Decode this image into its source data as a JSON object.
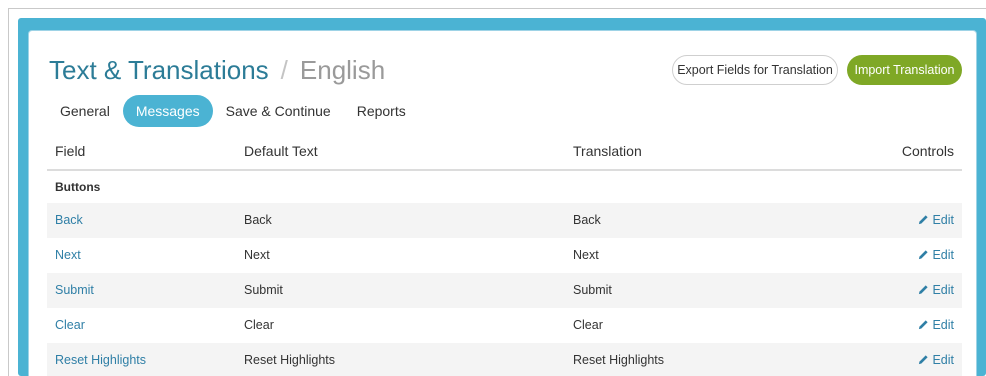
{
  "header": {
    "title": "Text & Translations",
    "separator": "/",
    "language": "English"
  },
  "buttons": {
    "export": "Export Fields for Translation",
    "import": "Import Translation"
  },
  "tabs": [
    {
      "label": "General",
      "active": false
    },
    {
      "label": "Messages",
      "active": true
    },
    {
      "label": "Save & Continue",
      "active": false
    },
    {
      "label": "Reports",
      "active": false
    }
  ],
  "table": {
    "columns": [
      "Field",
      "Default Text",
      "Translation",
      "Controls"
    ],
    "group": "Buttons",
    "rows": [
      {
        "field": "Back",
        "default": "Back",
        "translation": "Back",
        "control": "Edit"
      },
      {
        "field": "Next",
        "default": "Next",
        "translation": "Next",
        "control": "Edit"
      },
      {
        "field": "Submit",
        "default": "Submit",
        "translation": "Submit",
        "control": "Edit"
      },
      {
        "field": "Clear",
        "default": "Clear",
        "translation": "Clear",
        "control": "Edit"
      },
      {
        "field": "Reset Highlights",
        "default": "Reset Highlights",
        "translation": "Reset Highlights",
        "control": "Edit"
      }
    ]
  },
  "colors": {
    "frame": "#4bb3d3",
    "title": "#2c7c97",
    "import_button": "#7fa826",
    "link": "#2f7fa6"
  },
  "icons": {
    "edit": "pencil-icon"
  }
}
